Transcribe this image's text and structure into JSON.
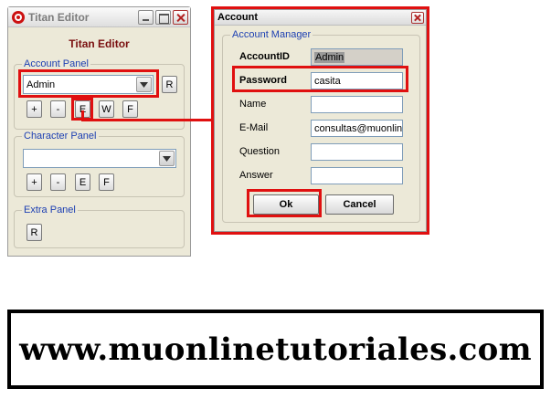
{
  "titan_window": {
    "title": "Titan Editor",
    "heading": "Titan Editor",
    "account_panel": {
      "legend": "Account Panel",
      "selected_account": "Admin",
      "refresh_label": "R",
      "buttons": [
        "+",
        "-",
        "E",
        "W",
        "F"
      ]
    },
    "character_panel": {
      "legend": "Character Panel",
      "selected_character": "",
      "buttons": [
        "+",
        "-",
        "E",
        "F"
      ]
    },
    "extra_panel": {
      "legend": "Extra Panel",
      "refresh_label": "R"
    }
  },
  "account_window": {
    "title": "Account",
    "group_legend": "Account Manager",
    "fields": {
      "account_id": {
        "label": "AccountID",
        "value": "Admin"
      },
      "password": {
        "label": "Password",
        "value": "casita"
      },
      "name": {
        "label": "Name",
        "value": ""
      },
      "email": {
        "label": "E-Mail",
        "value": "consultas@muonlin"
      },
      "question": {
        "label": "Question",
        "value": ""
      },
      "answer": {
        "label": "Answer",
        "value": ""
      }
    },
    "ok_label": "Ok",
    "cancel_label": "Cancel"
  },
  "banner": {
    "text": "www.muonlinetutoriales.com"
  },
  "colors": {
    "highlight": "#e01010",
    "legend": "#1c3fb2",
    "heading": "#7a1010",
    "window_bg": "#ece9d8"
  }
}
